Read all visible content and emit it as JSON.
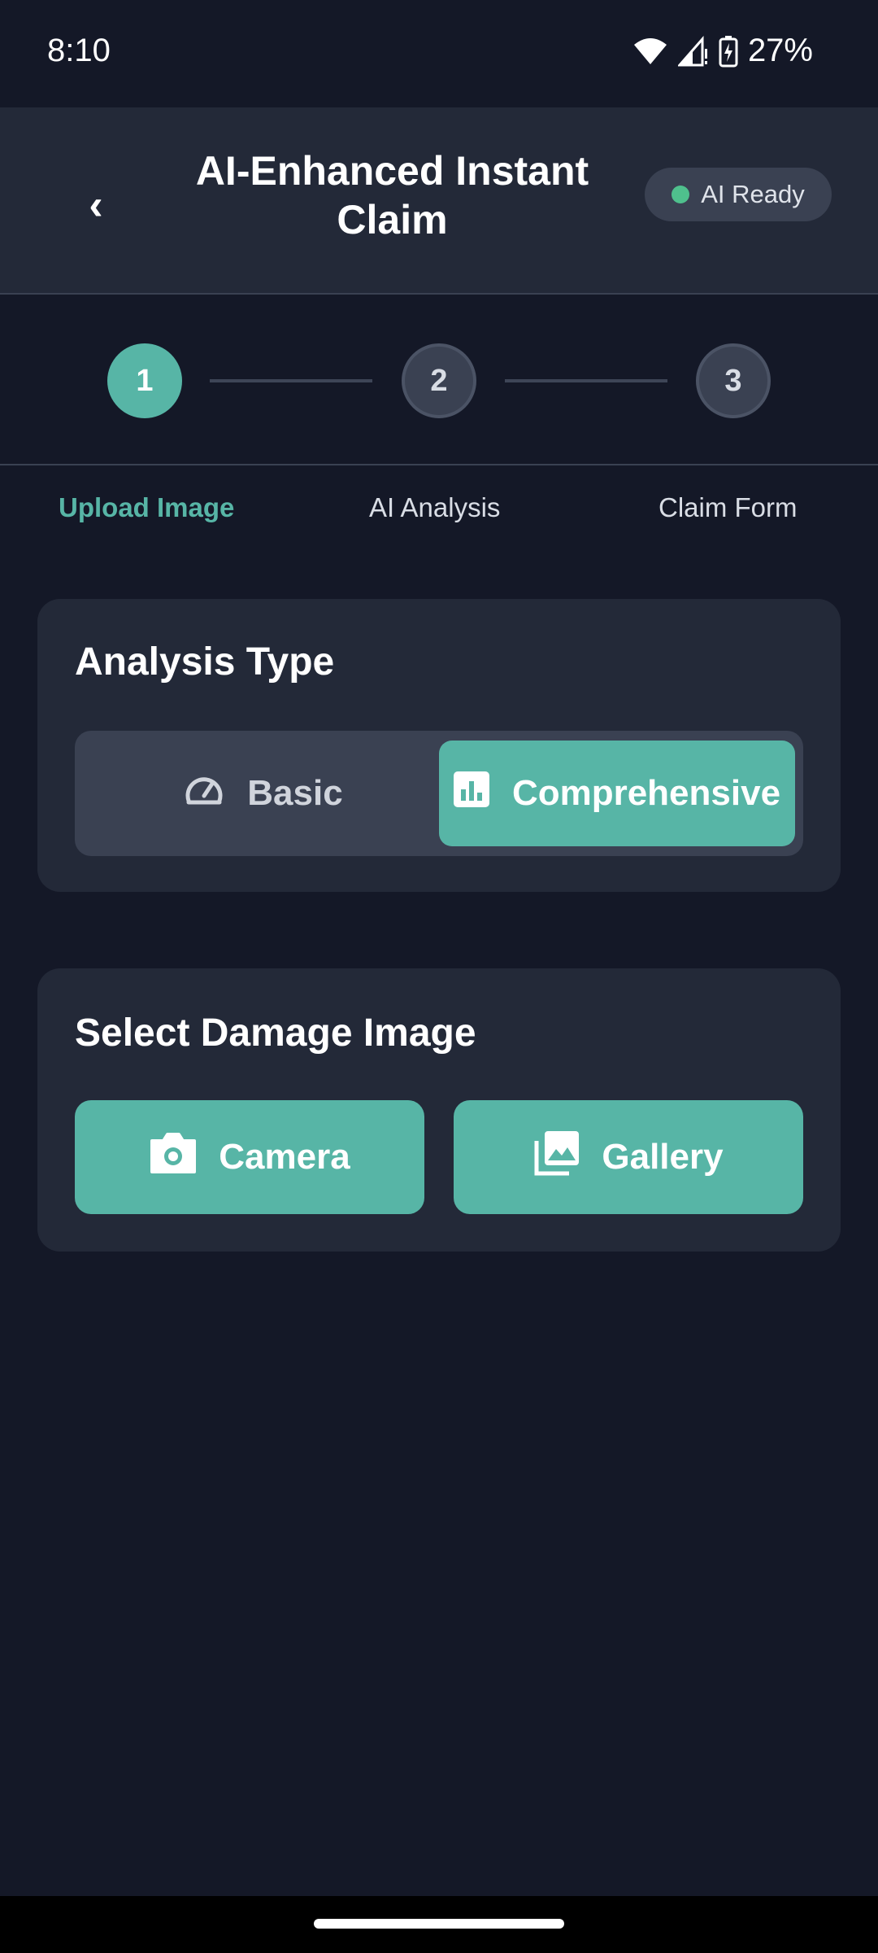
{
  "status_bar": {
    "time": "8:10",
    "battery": "27%"
  },
  "header": {
    "back_label": "‹",
    "title": "AI-Enhanced Instant Claim",
    "badge": "AI Ready"
  },
  "stepper": {
    "steps": [
      {
        "number": "1",
        "label": "Upload Image"
      },
      {
        "number": "2",
        "label": "AI Analysis"
      },
      {
        "number": "3",
        "label": "Claim Form"
      }
    ],
    "active_step": 1
  },
  "analysis_type": {
    "title": "Analysis Type",
    "options": [
      "Basic",
      "Comprehensive"
    ],
    "selected": "Comprehensive"
  },
  "damage_image": {
    "title": "Select Damage Image",
    "camera_label": "Camera",
    "gallery_label": "Gallery"
  },
  "colors": {
    "accent": "#57b5a6",
    "background": "#141827",
    "card": "#232938",
    "status_dot": "#4fc08d"
  }
}
